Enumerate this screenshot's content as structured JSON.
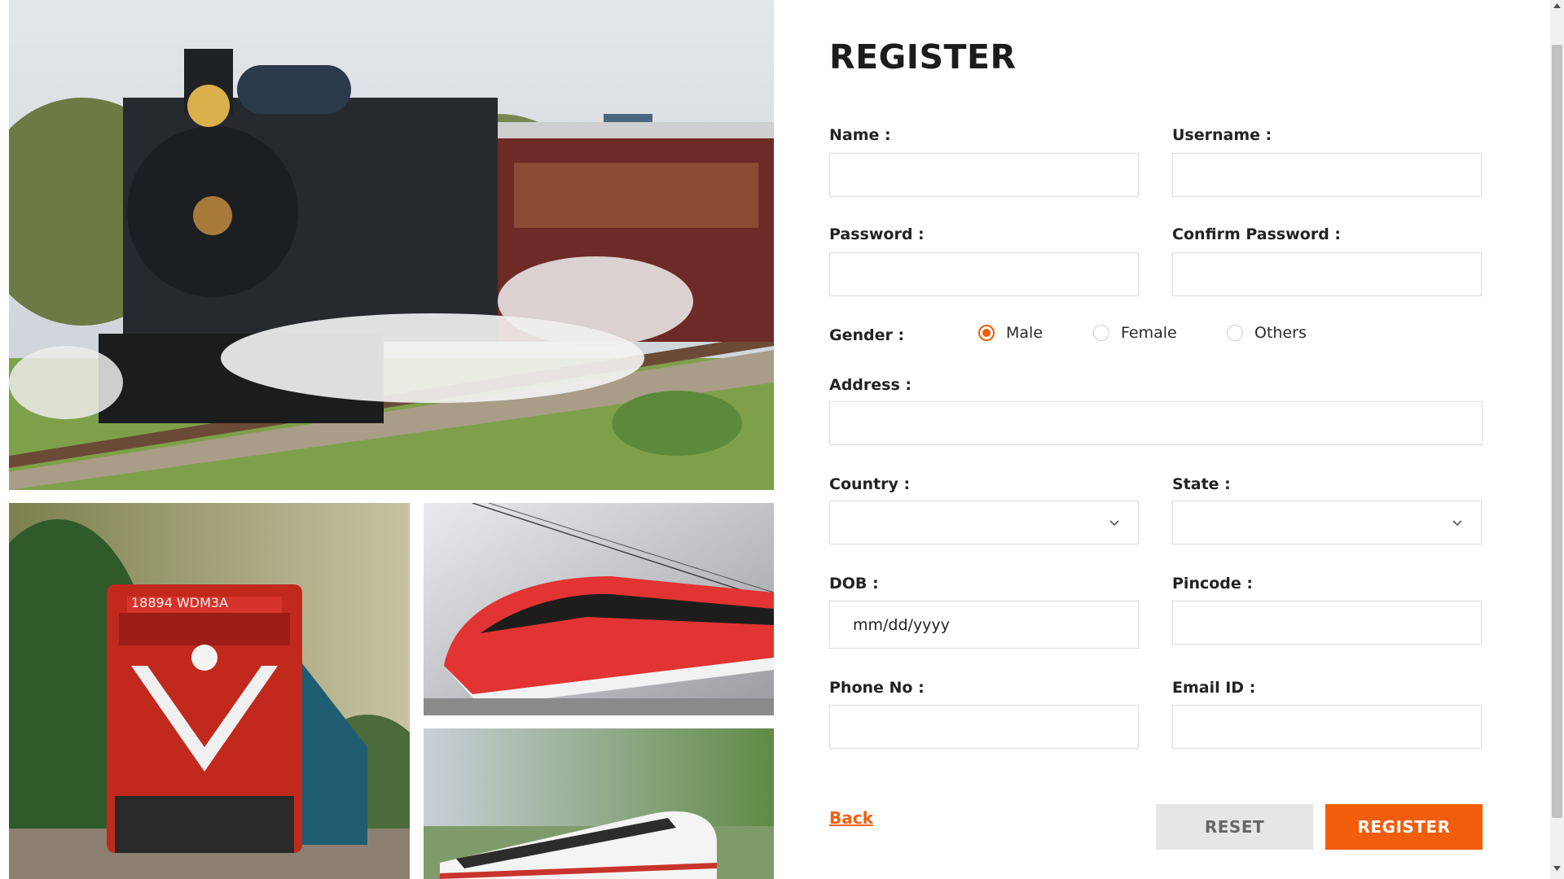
{
  "colors": {
    "accent": "#f25d0c",
    "reset_bg": "#e6e6e6",
    "border": "#dcdcdc"
  },
  "images": {
    "steam": "steam-locomotive-photo",
    "diesel": "diesel-locomotive-photo",
    "red_train": "red-high-speed-train-photo",
    "white_train": "white-high-speed-train-photo"
  },
  "form": {
    "title": "REGISTER",
    "name_label": "Name :",
    "username_label": "Username :",
    "password_label": "Password :",
    "confirm_password_label": "Confirm Password :",
    "gender_label": "Gender :",
    "gender_options": [
      "Male",
      "Female",
      "Others"
    ],
    "gender_selected": "Male",
    "address_label": "Address :",
    "country_label": "Country :",
    "state_label": "State :",
    "dob_label": "DOB :",
    "dob_placeholder": "mm/dd/yyyy",
    "pincode_label": "Pincode :",
    "phone_label": "Phone No :",
    "email_label": "Email ID :",
    "back_label": "Back",
    "reset_label": "RESET",
    "register_label": "REGISTER"
  }
}
